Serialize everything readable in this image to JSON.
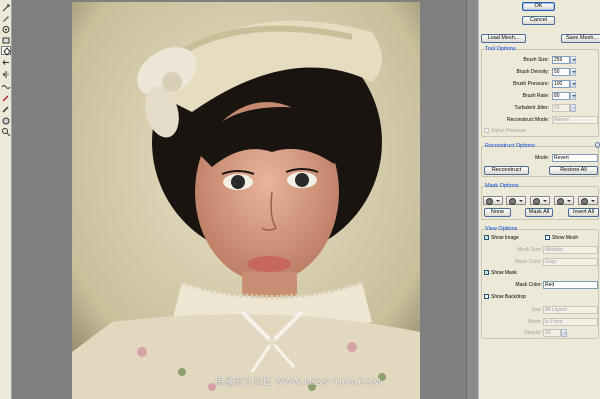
{
  "dialog": {
    "ok": "OK",
    "cancel": "Cancel",
    "load_mesh": "Load Mesh...",
    "save_mesh": "Save Mesh..."
  },
  "tool_options": {
    "title": "Tool Options",
    "brush_size": {
      "label": "Brush Size:",
      "value": "259"
    },
    "brush_density": {
      "label": "Brush Density:",
      "value": "50"
    },
    "brush_pressure": {
      "label": "Brush Pressure:",
      "value": "100"
    },
    "brush_rate": {
      "label": "Brush Rate:",
      "value": "80"
    },
    "turbulent_jitter": {
      "label": "Turbulent Jitter:",
      "value": "50"
    },
    "reconstruct_mode": {
      "label": "Reconstruct Mode:",
      "value": "Revert"
    },
    "stylus_pressure": "Stylus Pressure"
  },
  "reconstruct_options": {
    "title": "Reconstruct Options",
    "mode_label": "Mode:",
    "mode_value": "Revert",
    "reconstruct": "Reconstruct",
    "restore_all": "Restore All"
  },
  "mask_options": {
    "title": "Mask Options",
    "none": "None",
    "mask_all": "Mask All",
    "invert_all": "Invert All"
  },
  "view_options": {
    "title": "View Options",
    "show_image": "Show Image",
    "show_mesh": "Show Mesh",
    "show_image_checked": true,
    "show_mesh_checked": false,
    "mesh_size": {
      "label": "Mesh Size:",
      "value": "Medium"
    },
    "mesh_color": {
      "label": "Mesh Color:",
      "value": "Gray"
    },
    "show_mask": "Show Mask",
    "show_mask_checked": true,
    "mask_color": {
      "label": "Mask Color:",
      "value": "Red"
    },
    "show_backdrop": "Show Backdrop",
    "show_backdrop_checked": false,
    "use": {
      "label": "Use:",
      "value": "All Layers"
    },
    "mode": {
      "label": "Mode:",
      "value": "In Front"
    },
    "opacity": {
      "label": "Opacity:",
      "value": "50"
    }
  },
  "tools": [
    "forward-warp-icon",
    "reconstruct-icon",
    "twirl-icon",
    "pucker-icon",
    "bloat-icon",
    "push-left-icon",
    "mirror-icon",
    "turbulence-icon",
    "freeze-mask-icon",
    "thaw-mask-icon",
    "hand-icon",
    "zoom-icon"
  ],
  "watermark": "思缘设计论坛 WWW.MISSYUAN.COM"
}
